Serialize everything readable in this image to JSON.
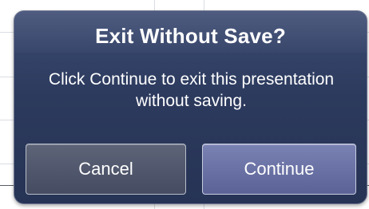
{
  "dialog": {
    "title": "Exit Without Save?",
    "message": "Click Continue to exit this presentation without saving.",
    "buttons": {
      "cancel_label": "Cancel",
      "continue_label": "Continue"
    }
  },
  "colors": {
    "dialog_background": "#2f3c60",
    "cancel_button": "#4f566c",
    "continue_button": "#6b73a6",
    "text": "#ffffff"
  }
}
